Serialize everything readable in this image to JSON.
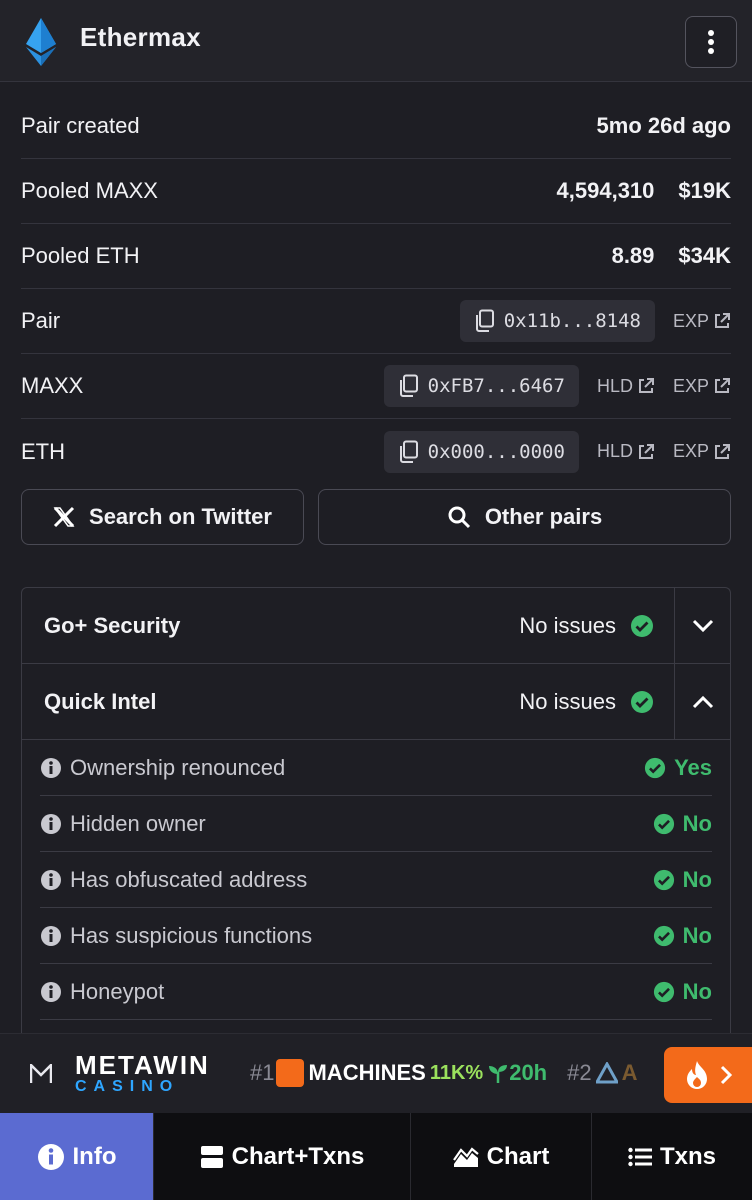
{
  "header": {
    "title": "Ethermax",
    "menu_icon": "kebab-menu-icon"
  },
  "info_rows": [
    {
      "label": "Pair created",
      "value": "5mo 26d ago"
    },
    {
      "label": "Pooled MAXX",
      "amount": "4,594,310",
      "usd": "$19K"
    },
    {
      "label": "Pooled ETH",
      "amount": "8.89",
      "usd": "$34K"
    }
  ],
  "addresses": [
    {
      "label": "Pair",
      "address": "0x11b...8148",
      "links": [
        "EXP"
      ]
    },
    {
      "label": "MAXX",
      "address": "0xFB7...6467",
      "links": [
        "HLD",
        "EXP"
      ]
    },
    {
      "label": "ETH",
      "address": "0x000...0000",
      "links": [
        "HLD",
        "EXP"
      ]
    }
  ],
  "buttons": {
    "twitter": "Search on Twitter",
    "other_pairs": "Other pairs"
  },
  "security": [
    {
      "name": "Go+ Security",
      "status": "No issues",
      "expanded": false
    },
    {
      "name": "Quick Intel",
      "status": "No issues",
      "expanded": true
    }
  ],
  "quick_intel": [
    {
      "label": "Ownership renounced",
      "result": "Yes"
    },
    {
      "label": "Hidden owner",
      "result": "No"
    },
    {
      "label": "Has obfuscated address",
      "result": "No"
    },
    {
      "label": "Has suspicious functions",
      "result": "No"
    },
    {
      "label": "Honeypot",
      "result": "No"
    }
  ],
  "promo": {
    "brand_top": "METAWIN",
    "brand_bottom": "CASINO",
    "trend1_rank": "#1",
    "trend1_name": "MACHINES",
    "trend1_pct": "11K%",
    "trend1_age": "20h",
    "trend2_rank": "#2",
    "trend2_name": "A"
  },
  "tabs": [
    {
      "label": "Info",
      "active": true
    },
    {
      "label": "Chart+Txns",
      "active": false
    },
    {
      "label": "Chart",
      "active": false
    },
    {
      "label": "Txns",
      "active": false
    }
  ],
  "colors": {
    "accent": "#5b6bd1",
    "ok": "#3fbb6e",
    "fire": "#f36a1a",
    "twitter_link": "#2ea6ff"
  }
}
